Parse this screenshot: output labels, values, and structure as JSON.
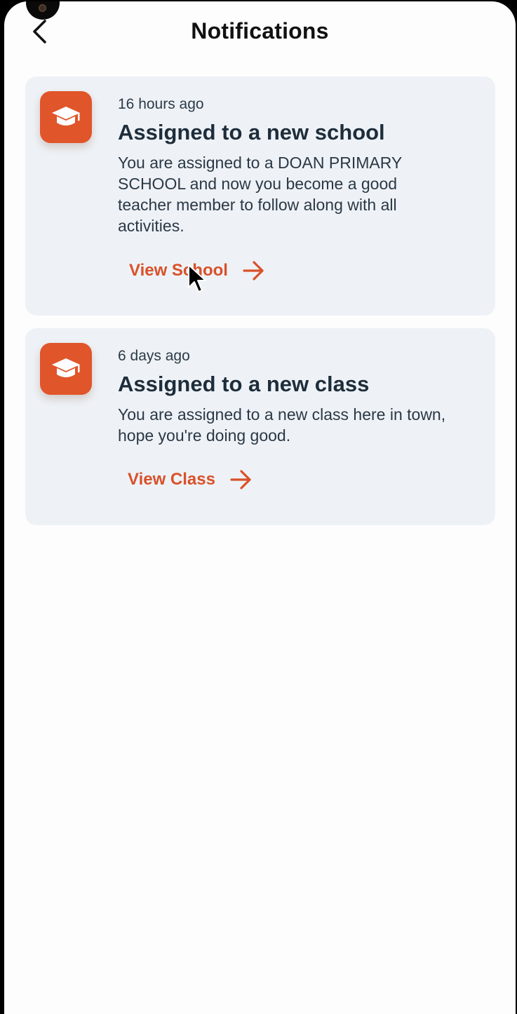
{
  "header": {
    "title": "Notifications"
  },
  "icons": {
    "back": "chevron-left-icon",
    "notification": "graduation-cap-icon",
    "action": "arrow-right-icon"
  },
  "colors": {
    "accent": "#e0552a",
    "link": "#d9512a",
    "card_background": "#eef2f6",
    "page_background": "#fdfdfd",
    "title_text": "#1e2d3b"
  },
  "notifications": [
    {
      "time": "16 hours ago",
      "title": "Assigned to a new school",
      "description": "You are assigned to  a DOAN PRIMARY SCHOOL and now you become a good teacher member to follow along with all activities.",
      "action_label": "View School"
    },
    {
      "time": "6 days ago",
      "title": "Assigned to a new class",
      "description": "You are assigned to a new class here in town, hope you're doing good.",
      "action_label": "View Class"
    }
  ]
}
